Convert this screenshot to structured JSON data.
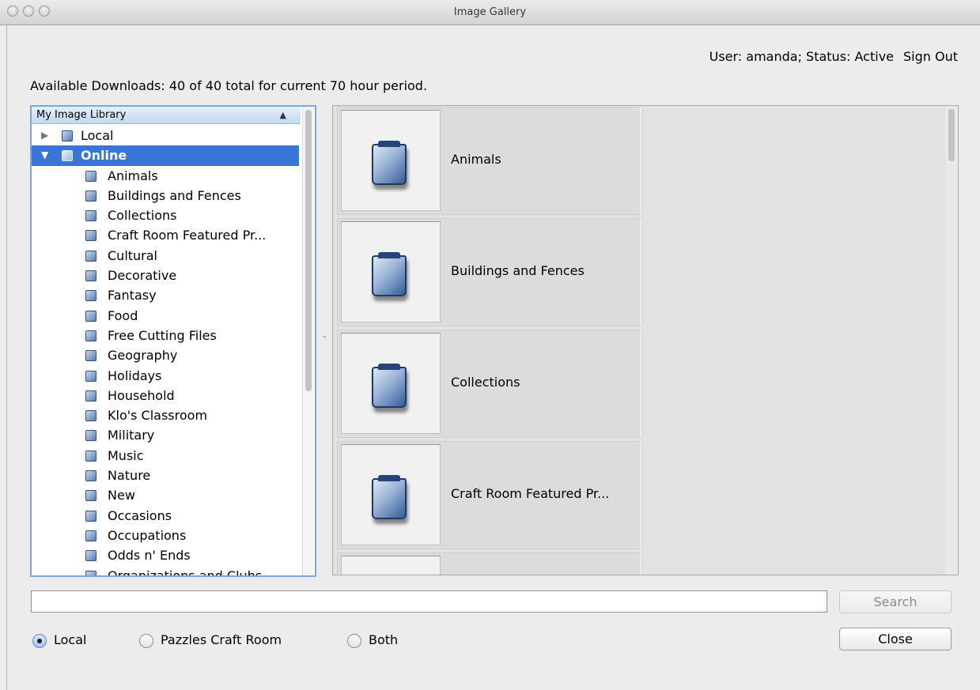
{
  "window": {
    "title": "Image Gallery"
  },
  "header": {
    "user_status": "User: amanda; Status: Active",
    "sign_out": "Sign Out",
    "downloads": "Available Downloads: 40 of 40 total for current 70 hour period."
  },
  "tree": {
    "title": "My Image Library",
    "root_items": [
      {
        "label": "Local",
        "expanded": false
      },
      {
        "label": "Online",
        "expanded": true,
        "selected": true
      }
    ],
    "online_children": [
      "Animals",
      "Buildings and Fences",
      "Collections",
      "Craft Room Featured Pr...",
      "Cultural",
      "Decorative",
      "Fantasy",
      "Food",
      "Free Cutting Files",
      "Geography",
      "Holidays",
      "Household",
      "Klo's Classroom",
      "Military",
      "Music",
      "Nature",
      "New",
      "Occasions",
      "Occupations",
      "Odds n' Ends",
      "Organizations and Clubs"
    ]
  },
  "gallery": {
    "cards": [
      {
        "label": "Animals"
      },
      {
        "label": "Buildings and Fences"
      },
      {
        "label": "Collections"
      },
      {
        "label": "Craft Room Featured Pr..."
      },
      {
        "label": ""
      }
    ]
  },
  "search": {
    "value": "",
    "button": "Search"
  },
  "scope": {
    "options": [
      "Local",
      "Pazzles Craft Room",
      "Both"
    ],
    "selected": "Local"
  },
  "footer": {
    "close": "Close"
  }
}
